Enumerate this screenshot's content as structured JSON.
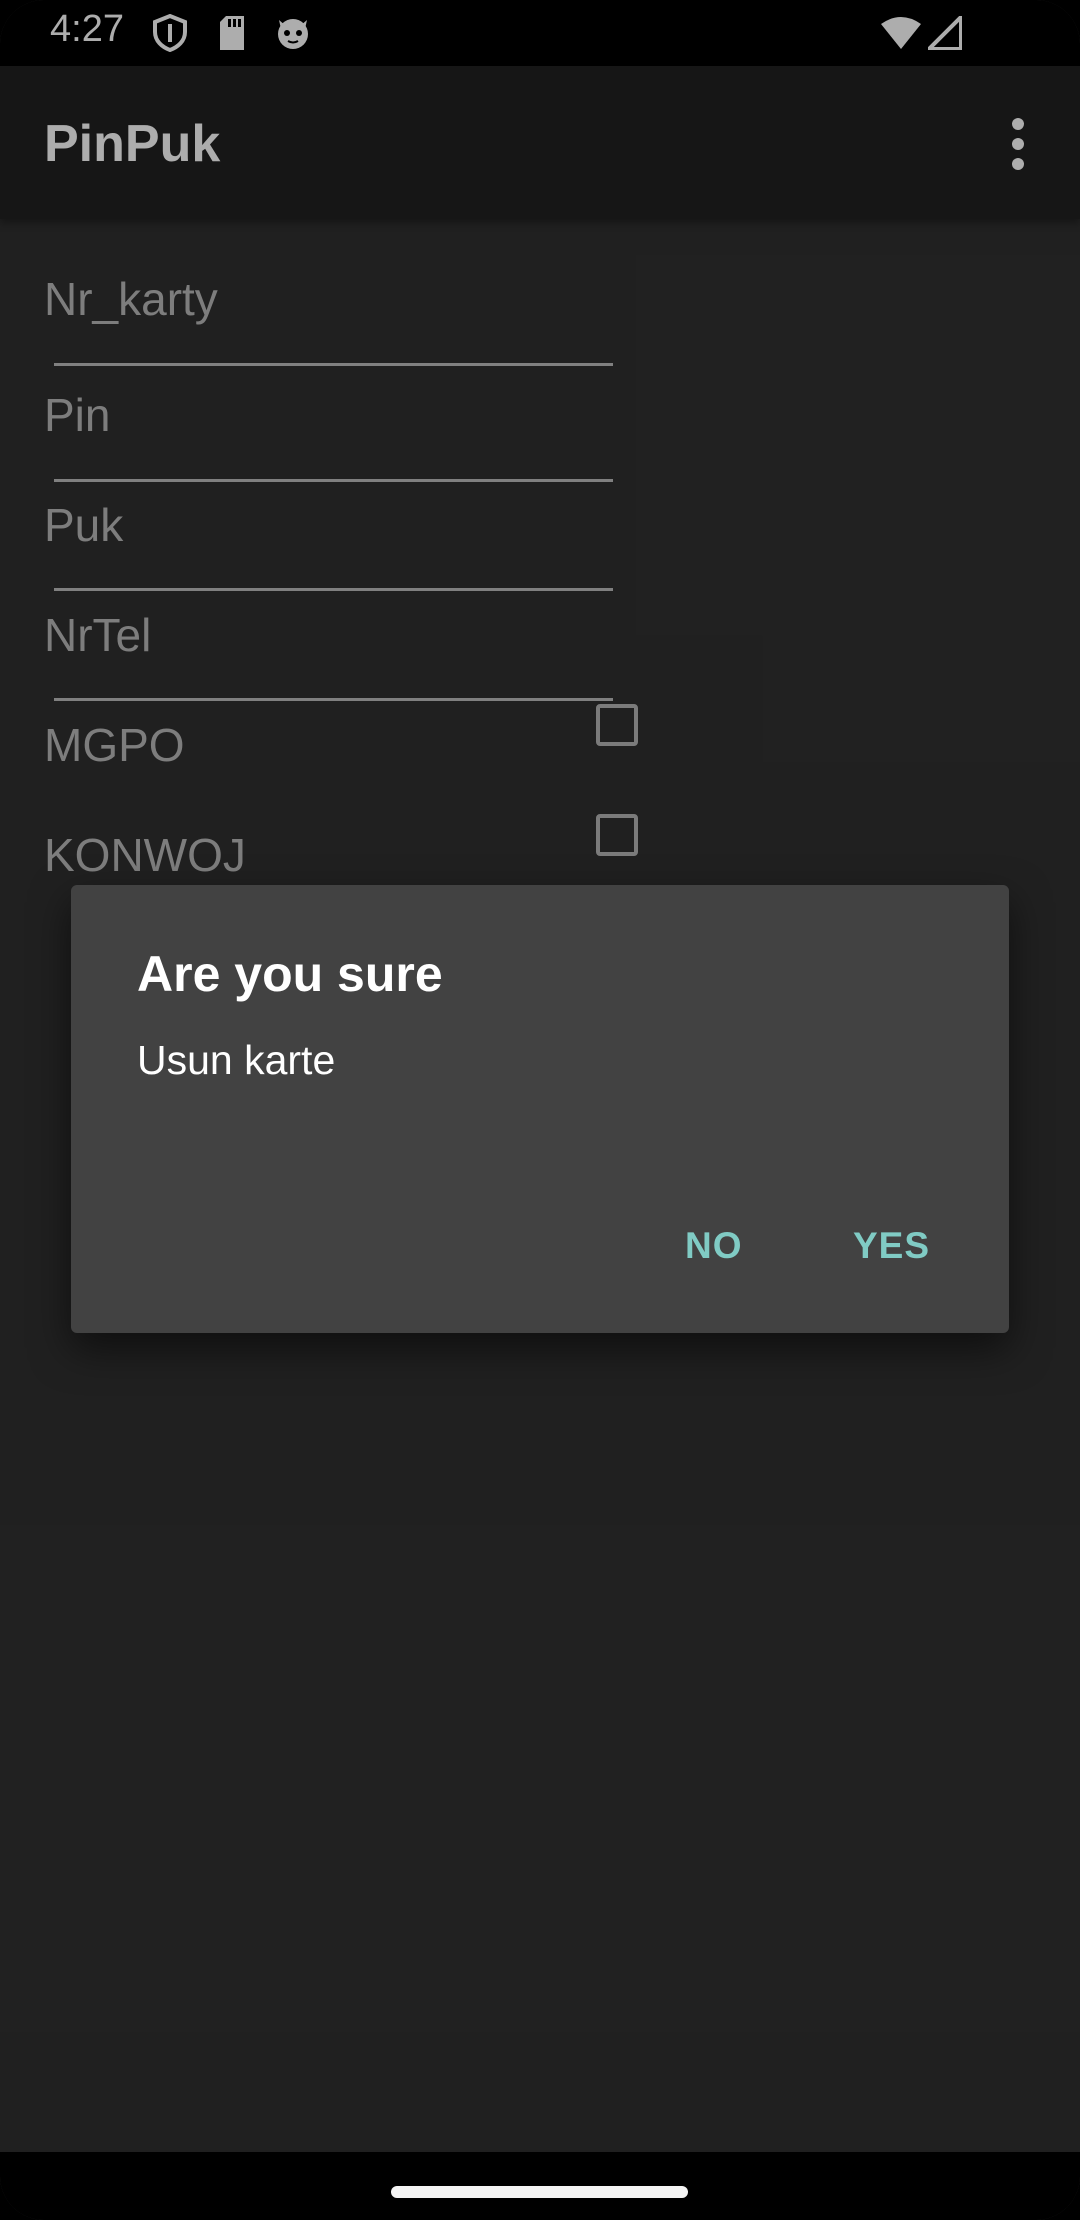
{
  "status_bar": {
    "time": "4:27",
    "icons": [
      "shield-icon",
      "sd-card-icon",
      "cat-notification-icon",
      "wifi-icon",
      "cell-signal-icon"
    ]
  },
  "app_bar": {
    "title": "PinPuk",
    "menu_icon": "more-vert-icon"
  },
  "form": {
    "fields": [
      {
        "label": "Nr_karty"
      },
      {
        "label": "Pin"
      },
      {
        "label": "Puk"
      },
      {
        "label": "NrTel"
      }
    ],
    "checkboxes": [
      {
        "label": "MGPO",
        "checked": false
      },
      {
        "label": "KONWOJ",
        "checked": false
      }
    ]
  },
  "dialog": {
    "title": "Are you sure",
    "message": "Usun karte",
    "negative_label": "NO",
    "positive_label": "YES"
  },
  "colors": {
    "background": "#303030",
    "app_bar": "#212121",
    "dialog": "#424242",
    "accent": "#80cbc4"
  }
}
